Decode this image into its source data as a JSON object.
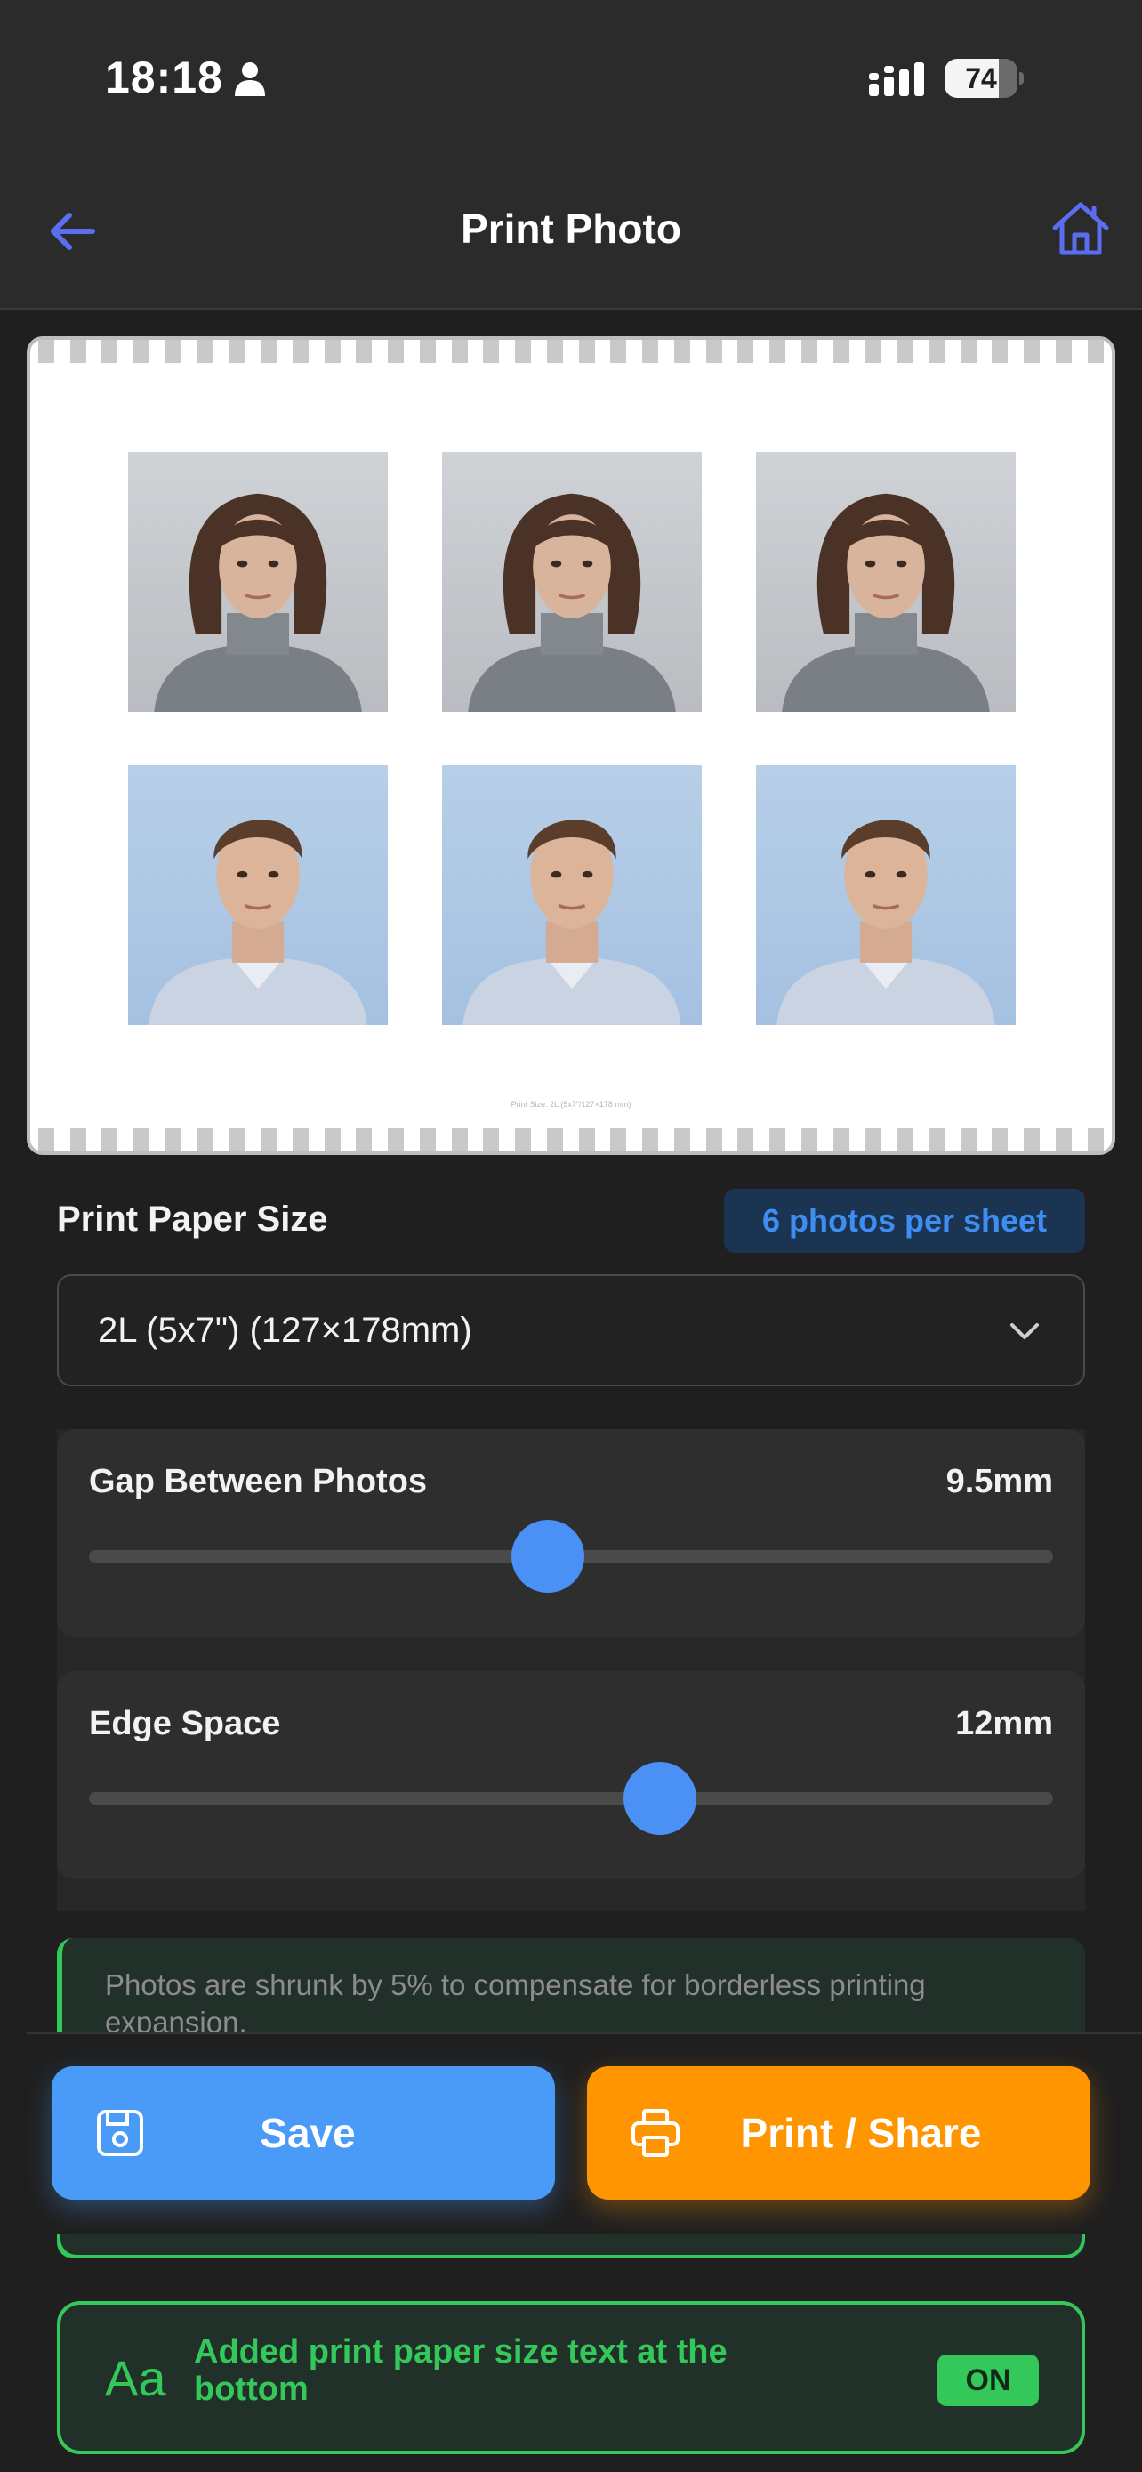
{
  "status_bar": {
    "time": "18:18",
    "battery": "74",
    "battery_level": 0.74,
    "icons": [
      "person-icon",
      "signal-icon",
      "battery-icon"
    ]
  },
  "header": {
    "title": "Print Photo",
    "back_icon": "arrow-left-icon",
    "home_icon": "home-icon",
    "accent": "#5b6ef0"
  },
  "preview": {
    "rows": [
      {
        "subject": "female",
        "count": 3
      },
      {
        "subject": "male",
        "count": 3
      }
    ],
    "caption": "Print Size: 2L (5x7\"/127×178 mm)"
  },
  "paper_size": {
    "label": "Print Paper Size",
    "badge": "6 photos per sheet",
    "selected": "2L (5x7\") (127×178mm)"
  },
  "sliders": {
    "gap": {
      "label": "Gap Between Photos",
      "value": "9.5mm",
      "position": 0.476
    },
    "edge": {
      "label": "Edge Space",
      "value": "12mm",
      "position": 0.592
    }
  },
  "notice": {
    "text": "Photos are shrunk by 5% to compensate for borderless printing expansion."
  },
  "actions": {
    "save_label": "Save",
    "print_label": "Print / Share"
  },
  "text_toggle": {
    "icon_label": "Aa",
    "label": "Added print paper size text at the bottom",
    "state": "ON"
  },
  "colors": {
    "save": "#4a9af8",
    "print": "#ff9500",
    "green": "#34c759",
    "badge_text": "#3d8ef0"
  }
}
